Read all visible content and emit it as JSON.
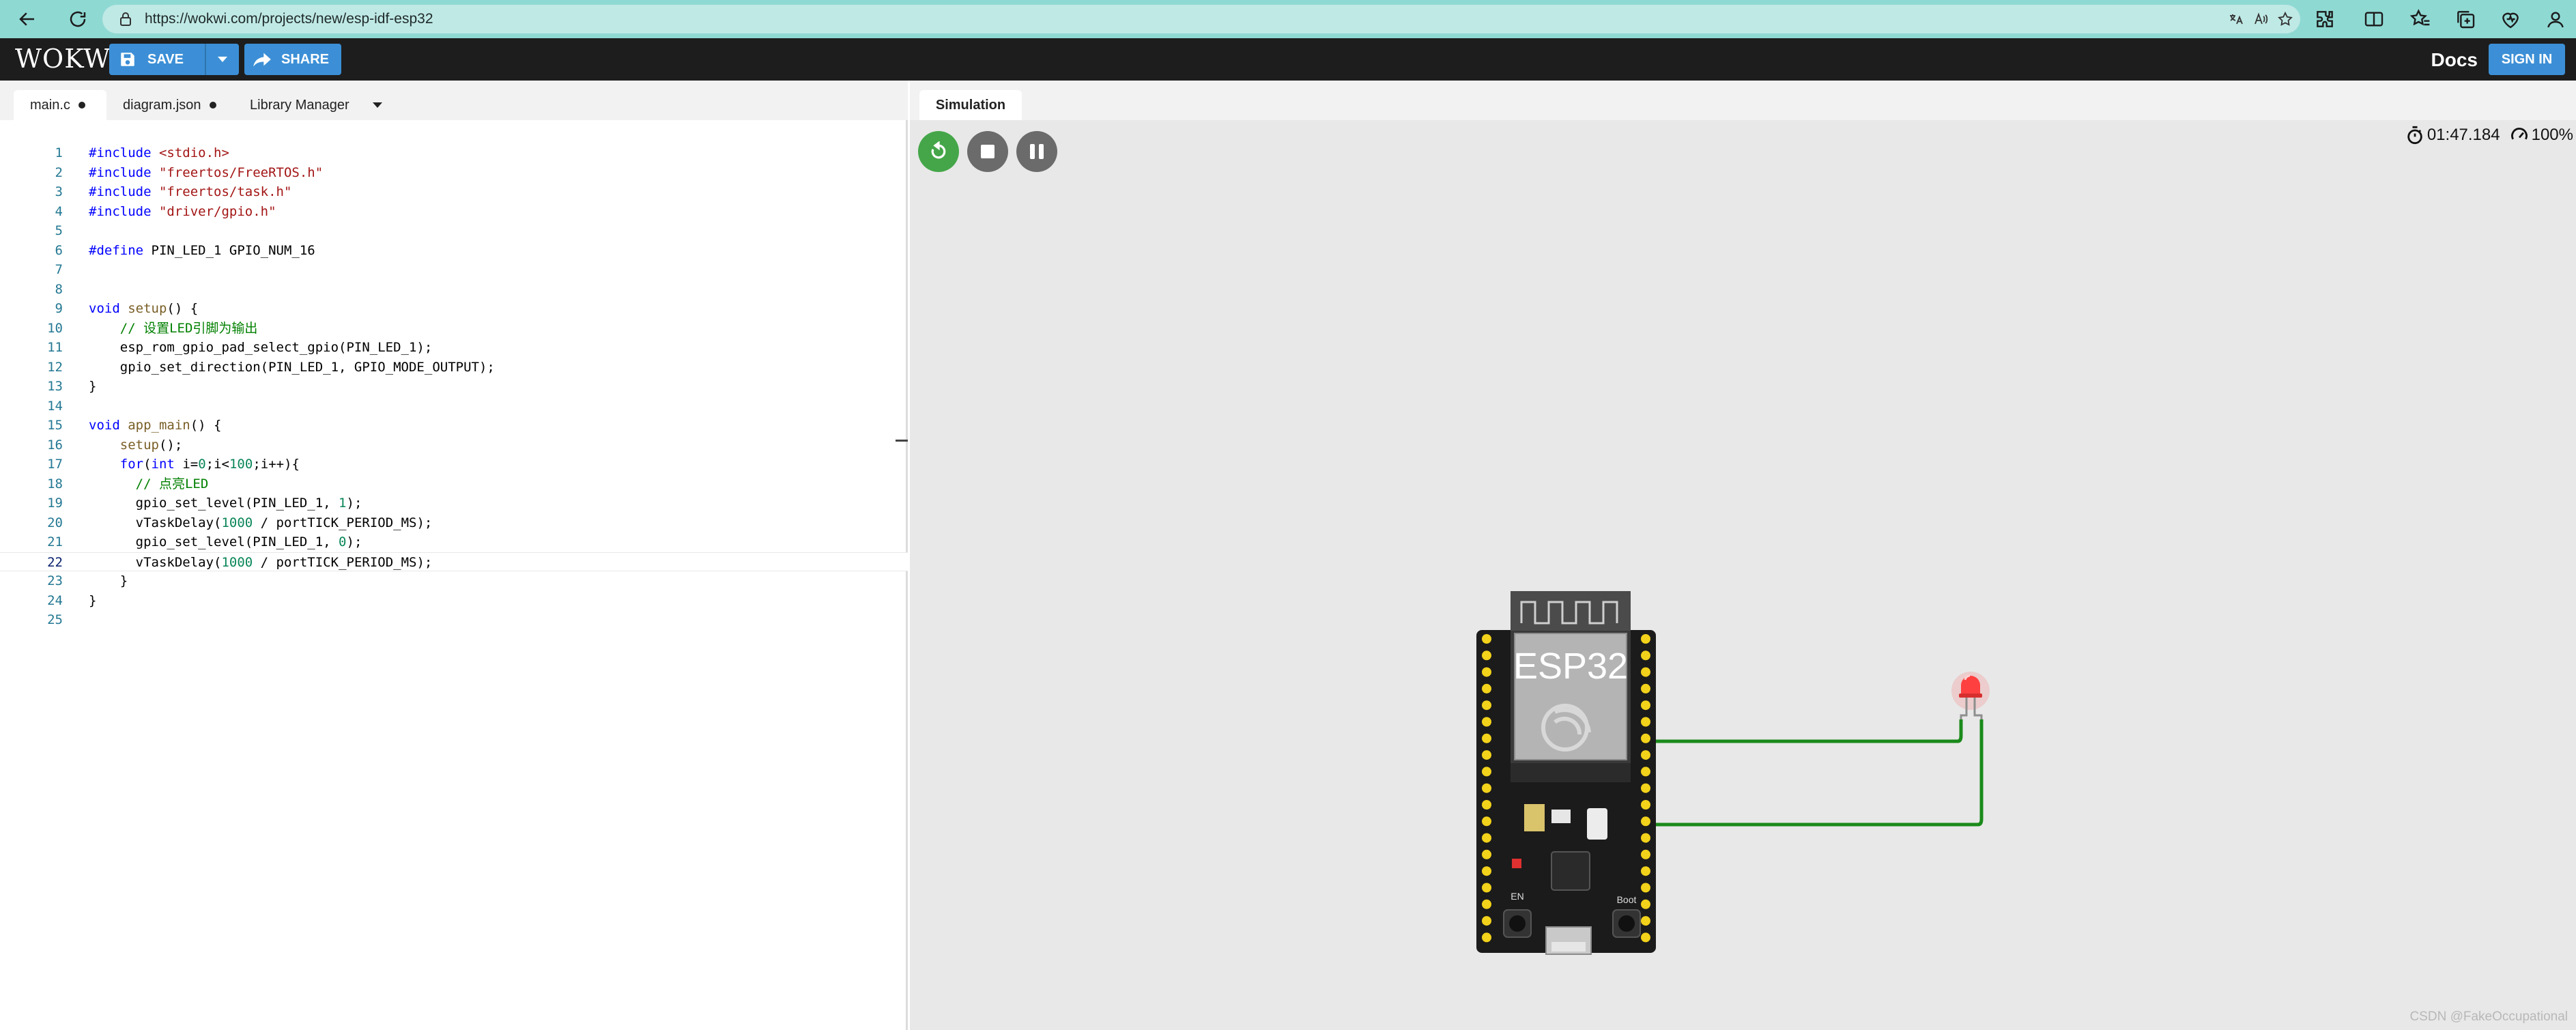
{
  "browser": {
    "url": "https://wokwi.com/projects/new/esp-idf-esp32"
  },
  "header": {
    "logo": "WOKWI",
    "save_label": "SAVE",
    "share_label": "SHARE",
    "docs_label": "Docs",
    "signin_label": "SIGN IN"
  },
  "editor": {
    "tabs": [
      {
        "label": "main.c",
        "modified": true
      },
      {
        "label": "diagram.json",
        "modified": true
      },
      {
        "label": "Library Manager"
      }
    ],
    "current_line": 22,
    "lines": [
      {
        "n": "1",
        "text": "#include <stdio.h>"
      },
      {
        "n": "2",
        "text": "#include \"freertos/FreeRTOS.h\""
      },
      {
        "n": "3",
        "text": "#include \"freertos/task.h\""
      },
      {
        "n": "4",
        "text": "#include \"driver/gpio.h\""
      },
      {
        "n": "5",
        "text": ""
      },
      {
        "n": "6",
        "text": "#define PIN_LED_1 GPIO_NUM_16"
      },
      {
        "n": "7",
        "text": ""
      },
      {
        "n": "8",
        "text": ""
      },
      {
        "n": "9",
        "text": "void setup() {"
      },
      {
        "n": "10",
        "text": "    // 设置LED引脚为输出"
      },
      {
        "n": "11",
        "text": "    esp_rom_gpio_pad_select_gpio(PIN_LED_1);"
      },
      {
        "n": "12",
        "text": "    gpio_set_direction(PIN_LED_1, GPIO_MODE_OUTPUT);"
      },
      {
        "n": "13",
        "text": "}"
      },
      {
        "n": "14",
        "text": ""
      },
      {
        "n": "15",
        "text": "void app_main() {"
      },
      {
        "n": "16",
        "text": "    setup();"
      },
      {
        "n": "17",
        "text": "    for(int i=0;i<100;i++){"
      },
      {
        "n": "18",
        "text": "      // 点亮LED"
      },
      {
        "n": "19",
        "text": "      gpio_set_level(PIN_LED_1, 1);"
      },
      {
        "n": "20",
        "text": "      vTaskDelay(1000 / portTICK_PERIOD_MS);"
      },
      {
        "n": "21",
        "text": "      gpio_set_level(PIN_LED_1, 0);"
      },
      {
        "n": "22",
        "text": "      vTaskDelay(1000 / portTICK_PERIOD_MS);"
      },
      {
        "n": "23",
        "text": "    }"
      },
      {
        "n": "24",
        "text": "}"
      },
      {
        "n": "25",
        "text": ""
      }
    ]
  },
  "simulation": {
    "tab_label": "Simulation",
    "timer": "01:47.184",
    "speed": "100%",
    "board_label": "ESP32",
    "boot_label": "Boot",
    "en_label": "EN",
    "wire_color": "#1a8a1a",
    "led_color": "#ff3b3b"
  },
  "watermark": "CSDN @FakeOccupational"
}
